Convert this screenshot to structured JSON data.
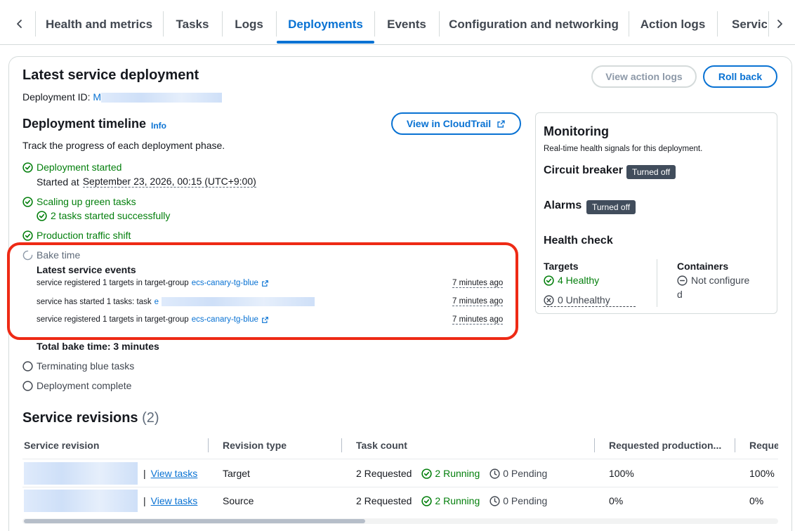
{
  "tabs": {
    "items": [
      {
        "label": "Health and metrics"
      },
      {
        "label": "Tasks"
      },
      {
        "label": "Logs"
      },
      {
        "label": "Deployments"
      },
      {
        "label": "Events"
      },
      {
        "label": "Configuration and networking"
      },
      {
        "label": "Action logs"
      },
      {
        "label": "Service"
      }
    ],
    "active": "Deployments"
  },
  "deployment": {
    "title": "Latest service deployment",
    "id_label": "Deployment ID:",
    "id_value": "M",
    "view_action_logs": "View action logs",
    "roll_back": "Roll back"
  },
  "timeline": {
    "title": "Deployment timeline",
    "info": "Info",
    "subtitle": "Track the progress of each deployment phase.",
    "cloudtrail_button": "View in CloudTrail",
    "steps": {
      "started": "Deployment started",
      "started_at_label": "Started at",
      "started_at": "September 23, 2026, 00:15 (UTC+9:00)",
      "scaling": "Scaling up green tasks",
      "scaling_detail": "2 tasks started successfully",
      "traffic": "Production traffic shift",
      "bake": "Bake time",
      "total_bake": "Total bake time: 3 minutes",
      "terminating": "Terminating blue tasks",
      "complete": "Deployment complete"
    },
    "events_title": "Latest service events",
    "events": [
      {
        "text": "service registered 1 targets in target-group",
        "link": "ecs-canary-tg-blue",
        "time": "7 minutes ago"
      },
      {
        "text": "service has started 1 tasks: task",
        "link": "e",
        "time": "7 minutes ago"
      },
      {
        "text": "service registered 1 targets in target-group",
        "link": "ecs-canary-tg-blue",
        "time": "7 minutes ago"
      }
    ]
  },
  "monitoring": {
    "title": "Monitoring",
    "subtitle": "Real-time health signals for this deployment.",
    "circuit_breaker": "Circuit breaker",
    "circuit_breaker_status": "Turned off",
    "alarms": "Alarms",
    "alarms_status": "Turned off",
    "health_check": "Health check",
    "targets_label": "Targets",
    "healthy": "4 Healthy",
    "unhealthy": "0 Unhealthy",
    "containers_label": "Containers",
    "containers_value_1": "Not configure",
    "containers_value_2": "d"
  },
  "revisions": {
    "title": "Service revisions",
    "count": "(2)",
    "columns": [
      "Service revision",
      "Revision type",
      "Task count",
      "Requested production...",
      "Reque"
    ],
    "rows": [
      {
        "view_tasks": "View tasks",
        "type": "Target",
        "requested": "2 Requested",
        "running": "2 Running",
        "pending": "0 Pending",
        "prod": "100%",
        "req2": "100%"
      },
      {
        "view_tasks": "View tasks",
        "type": "Source",
        "requested": "2 Requested",
        "running": "2 Running",
        "pending": "0 Pending",
        "prod": "0%",
        "req2": "0%"
      }
    ],
    "separator": "|"
  },
  "colors": {
    "accent": "#0972d3",
    "success": "#037f0c",
    "highlight": "#ee2a15",
    "badge": "#414d5c"
  }
}
